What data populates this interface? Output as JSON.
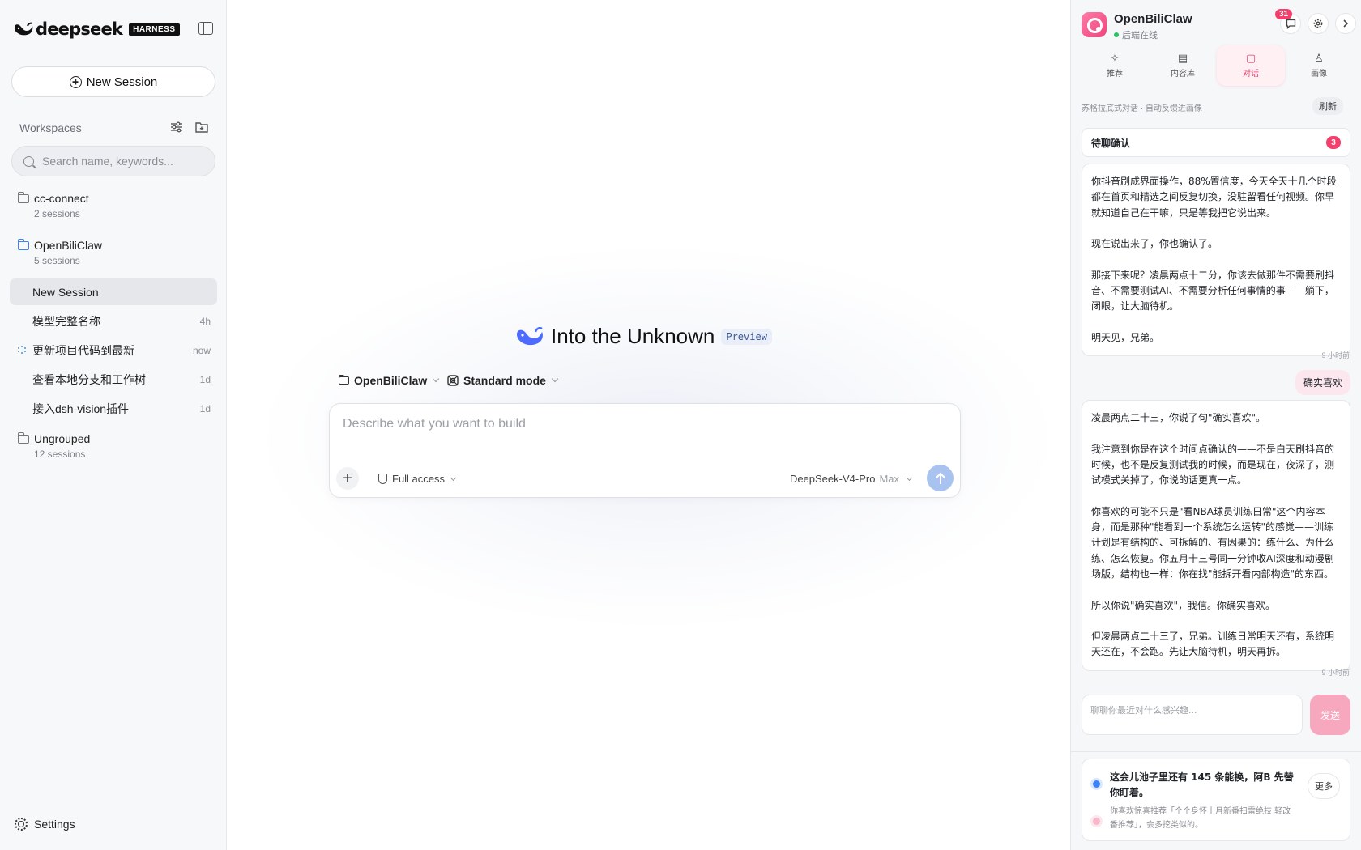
{
  "sidebar": {
    "brand_name": "deepseek",
    "brand_tag": "HARNESS",
    "new_session_label": "New Session",
    "workspaces_label": "Workspaces",
    "search_placeholder": "Search name, keywords...",
    "folders": [
      {
        "name": "cc-connect",
        "count": "2 sessions"
      },
      {
        "name": "OpenBiliClaw",
        "count": "5 sessions"
      },
      {
        "name": "Ungrouped",
        "count": "12 sessions"
      }
    ],
    "sessions": [
      {
        "label": "New Session",
        "time": ""
      },
      {
        "label": "模型完整名称",
        "time": "4h"
      },
      {
        "label": "更新项目代码到最新",
        "time": "now"
      },
      {
        "label": "查看本地分支和工作树",
        "time": "1d"
      },
      {
        "label": "接入dsh-vision插件",
        "time": "1d"
      }
    ],
    "settings_label": "Settings"
  },
  "main": {
    "title": "Into the Unknown",
    "badge": "Preview",
    "workspace_picker": "OpenBiliClaw",
    "mode_picker": "Standard mode",
    "composer_placeholder": "Describe what you want to build",
    "access_label": "Full access",
    "model_name": "DeepSeek-V4-Pro",
    "model_effort": "Max"
  },
  "panel": {
    "app_name": "OpenBiliClaw",
    "status": "后端在线",
    "notification_count": "31",
    "tabs": [
      {
        "label": "推荐",
        "icon": "✧"
      },
      {
        "label": "内容库",
        "icon": "▤"
      },
      {
        "label": "对话",
        "icon": "▢"
      },
      {
        "label": "画像",
        "icon": "♙"
      }
    ],
    "subtitle": "苏格拉底式对话 · 自动反馈进画像",
    "refresh_label": "刷新",
    "pending_label": "待聊确认",
    "pending_count": "3",
    "messages": [
      {
        "role": "assistant",
        "paragraphs": [
          "你抖音刷成界面操作，88%置信度，今天全天十几个时段都在首页和精选之间反复切换，没驻留看任何视频。你早就知道自己在干嘛，只是等我把它说出来。",
          "现在说出来了，你也确认了。",
          "那接下来呢？凌晨两点十二分，你该去做那件不需要刷抖音、不需要测试AI、不需要分析任何事情的事——躺下，闭眼，让大脑待机。",
          "明天见，兄弟。"
        ],
        "time": "9 小时前"
      },
      {
        "role": "user",
        "text": "确实喜欢"
      },
      {
        "role": "assistant",
        "paragraphs": [
          "凌晨两点二十三，你说了句\"确实喜欢\"。",
          "我注意到你是在这个时间点确认的——不是白天刷抖音的时候，也不是反复测试我的时候，而是现在，夜深了，测试模式关掉了，你说的话更真一点。",
          "你喜欢的可能不只是\"看NBA球员训练日常\"这个内容本身，而是那种\"能看到一个系统怎么运转\"的感觉——训练计划是有结构的、可拆解的、有因果的：练什么、为什么练、怎么恢复。你五月十三号同一分钟收AI深度和动漫剧场版，结构也一样：你在找\"能拆开看内部构造\"的东西。",
          "所以你说\"确实喜欢\"，我信。你确实喜欢。",
          "但凌晨两点二十三了，兄弟。训练日常明天还有，系统明天还在，不会跑。先让大脑待机，明天再拆。"
        ],
        "time": "9 小时前"
      }
    ],
    "input_placeholder": "聊聊你最近对什么感兴趣...",
    "send_label": "发送",
    "reco_line1": "这会儿池子里还有 145 条能换，阿B 先替你盯着。",
    "reco_line2": "你喜欢惊喜推荐「个个身怀十月新番扫雷绝技 轻改番推荐」，会多挖类似的。",
    "more_label": "更多"
  }
}
